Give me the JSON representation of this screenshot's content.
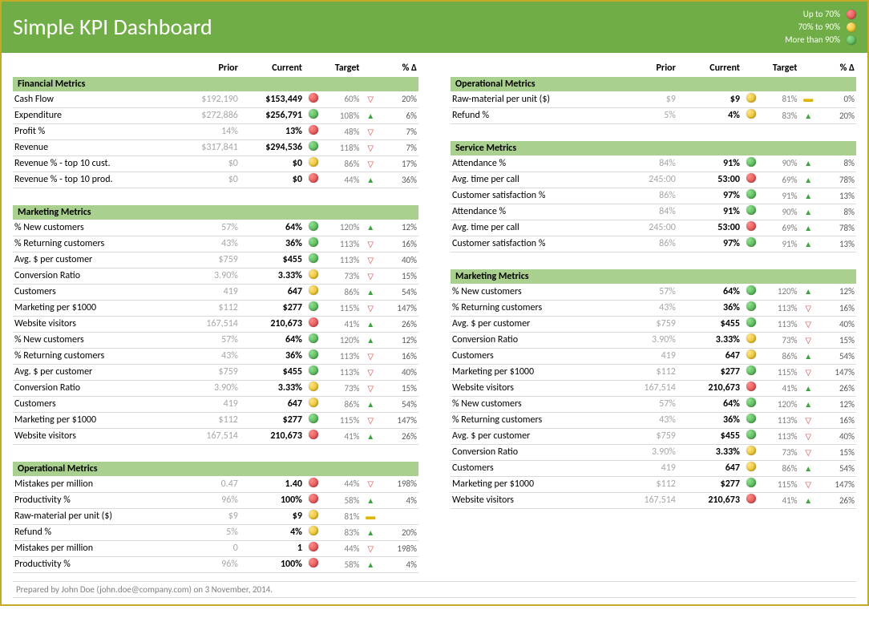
{
  "title": "Simple KPI Dashboard",
  "legend": [
    {
      "label": "Up to 70%",
      "color": "red"
    },
    {
      "label": "70% to 90%",
      "color": "yellow"
    },
    {
      "label": "More than 90%",
      "color": "green"
    }
  ],
  "columns": [
    "",
    "Prior",
    "Current",
    "Target",
    "% Δ"
  ],
  "footer": "Prepared by John Doe (john.doe@company.com) on 3 November, 2014.",
  "left": [
    {
      "section": "Financial Metrics",
      "rows": [
        {
          "name": "Cash Flow",
          "prior": "$192,190",
          "current": "$153,449",
          "status": "red",
          "target": "60%",
          "dir": "down",
          "delta": "20%"
        },
        {
          "name": "Expenditure",
          "prior": "$272,886",
          "current": "$256,791",
          "status": "green",
          "target": "108%",
          "dir": "up",
          "delta": "6%"
        },
        {
          "name": "Profit %",
          "prior": "14%",
          "current": "13%",
          "status": "red",
          "target": "48%",
          "dir": "down",
          "delta": "7%"
        },
        {
          "name": "Revenue",
          "prior": "$317,841",
          "current": "$294,536",
          "status": "green",
          "target": "118%",
          "dir": "down",
          "delta": "7%"
        },
        {
          "name": "Revenue % - top 10 cust.",
          "prior": "$0",
          "current": "$0",
          "status": "yellow",
          "target": "86%",
          "dir": "down",
          "delta": "17%"
        },
        {
          "name": "Revenue % - top 10 prod.",
          "prior": "$0",
          "current": "$0",
          "status": "red",
          "target": "44%",
          "dir": "up",
          "delta": "36%"
        }
      ]
    },
    {
      "section": "Marketing Metrics",
      "rows": [
        {
          "name": "% New customers",
          "prior": "57%",
          "current": "64%",
          "status": "green",
          "target": "120%",
          "dir": "up",
          "delta": "12%"
        },
        {
          "name": "% Returning customers",
          "prior": "43%",
          "current": "36%",
          "status": "green",
          "target": "113%",
          "dir": "down",
          "delta": "16%"
        },
        {
          "name": "Avg. $ per customer",
          "prior": "$759",
          "current": "$455",
          "status": "green",
          "target": "113%",
          "dir": "down",
          "delta": "40%"
        },
        {
          "name": "Conversion Ratio",
          "prior": "3.90%",
          "current": "3.33%",
          "status": "yellow",
          "target": "73%",
          "dir": "down",
          "delta": "15%"
        },
        {
          "name": "Customers",
          "prior": "419",
          "current": "647",
          "status": "yellow",
          "target": "86%",
          "dir": "up",
          "delta": "54%"
        },
        {
          "name": "Marketing per $1000",
          "prior": "$112",
          "current": "$277",
          "status": "green",
          "target": "115%",
          "dir": "down",
          "delta": "147%"
        },
        {
          "name": "Website visitors",
          "prior": "167,514",
          "current": "210,673",
          "status": "red",
          "target": "41%",
          "dir": "up",
          "delta": "26%"
        },
        {
          "name": "% New customers",
          "prior": "57%",
          "current": "64%",
          "status": "green",
          "target": "120%",
          "dir": "up",
          "delta": "12%"
        },
        {
          "name": "% Returning customers",
          "prior": "43%",
          "current": "36%",
          "status": "green",
          "target": "113%",
          "dir": "down",
          "delta": "16%"
        },
        {
          "name": "Avg. $ per customer",
          "prior": "$759",
          "current": "$455",
          "status": "green",
          "target": "113%",
          "dir": "down",
          "delta": "40%"
        },
        {
          "name": "Conversion Ratio",
          "prior": "3.90%",
          "current": "3.33%",
          "status": "yellow",
          "target": "73%",
          "dir": "down",
          "delta": "15%"
        },
        {
          "name": "Customers",
          "prior": "419",
          "current": "647",
          "status": "yellow",
          "target": "86%",
          "dir": "up",
          "delta": "54%"
        },
        {
          "name": "Marketing per $1000",
          "prior": "$112",
          "current": "$277",
          "status": "green",
          "target": "115%",
          "dir": "down",
          "delta": "147%"
        },
        {
          "name": "Website visitors",
          "prior": "167,514",
          "current": "210,673",
          "status": "red",
          "target": "41%",
          "dir": "up",
          "delta": "26%"
        }
      ]
    },
    {
      "section": "Operational Metrics",
      "rows": [
        {
          "name": "Mistakes per million",
          "prior": "0.47",
          "current": "1.40",
          "status": "red",
          "target": "44%",
          "dir": "down",
          "delta": "198%"
        },
        {
          "name": "Productivity %",
          "prior": "96%",
          "current": "100%",
          "status": "red",
          "target": "58%",
          "dir": "up",
          "delta": "4%"
        },
        {
          "name": "Raw-material per unit ($)",
          "prior": "$9",
          "current": "$9",
          "status": "yellow",
          "target": "81%",
          "dir": "flat",
          "delta": ""
        },
        {
          "name": "Refund %",
          "prior": "5%",
          "current": "4%",
          "status": "yellow",
          "target": "83%",
          "dir": "up",
          "delta": "20%"
        },
        {
          "name": "Mistakes per million",
          "prior": "0",
          "current": "1",
          "status": "red",
          "target": "44%",
          "dir": "down",
          "delta": "198%"
        },
        {
          "name": "Productivity %",
          "prior": "96%",
          "current": "100%",
          "status": "red",
          "target": "58%",
          "dir": "up",
          "delta": "4%"
        }
      ]
    }
  ],
  "right": [
    {
      "section": "Operational Metrics",
      "rows": [
        {
          "name": "Raw-material per unit ($)",
          "prior": "$9",
          "current": "$9",
          "status": "yellow",
          "target": "81%",
          "dir": "flat",
          "delta": "0%"
        },
        {
          "name": "Refund %",
          "prior": "5%",
          "current": "4%",
          "status": "yellow",
          "target": "83%",
          "dir": "up",
          "delta": "20%"
        }
      ]
    },
    {
      "section": "Service Metrics",
      "rows": [
        {
          "name": "Attendance %",
          "prior": "84%",
          "current": "91%",
          "status": "green",
          "target": "90%",
          "dir": "up",
          "delta": "8%"
        },
        {
          "name": "Avg. time per call",
          "prior": "245:00",
          "current": "53:00",
          "status": "red",
          "target": "69%",
          "dir": "up",
          "delta": "78%"
        },
        {
          "name": "Customer satisfaction %",
          "prior": "86%",
          "current": "97%",
          "status": "green",
          "target": "91%",
          "dir": "up",
          "delta": "13%"
        },
        {
          "name": "Attendance %",
          "prior": "84%",
          "current": "91%",
          "status": "green",
          "target": "90%",
          "dir": "up",
          "delta": "8%"
        },
        {
          "name": "Avg. time per call",
          "prior": "245:00",
          "current": "53:00",
          "status": "red",
          "target": "69%",
          "dir": "up",
          "delta": "78%"
        },
        {
          "name": "Customer satisfaction %",
          "prior": "86%",
          "current": "97%",
          "status": "green",
          "target": "91%",
          "dir": "up",
          "delta": "13%"
        }
      ]
    },
    {
      "section": "Marketing Metrics",
      "rows": [
        {
          "name": "% New customers",
          "prior": "57%",
          "current": "64%",
          "status": "green",
          "target": "120%",
          "dir": "up",
          "delta": "12%"
        },
        {
          "name": "% Returning customers",
          "prior": "43%",
          "current": "36%",
          "status": "green",
          "target": "113%",
          "dir": "down",
          "delta": "16%"
        },
        {
          "name": "Avg. $ per customer",
          "prior": "$759",
          "current": "$455",
          "status": "green",
          "target": "113%",
          "dir": "down",
          "delta": "40%"
        },
        {
          "name": "Conversion Ratio",
          "prior": "3.90%",
          "current": "3.33%",
          "status": "yellow",
          "target": "73%",
          "dir": "down",
          "delta": "15%"
        },
        {
          "name": "Customers",
          "prior": "419",
          "current": "647",
          "status": "yellow",
          "target": "86%",
          "dir": "up",
          "delta": "54%"
        },
        {
          "name": "Marketing per $1000",
          "prior": "$112",
          "current": "$277",
          "status": "green",
          "target": "115%",
          "dir": "down",
          "delta": "147%"
        },
        {
          "name": "Website visitors",
          "prior": "167,514",
          "current": "210,673",
          "status": "red",
          "target": "41%",
          "dir": "up",
          "delta": "26%"
        },
        {
          "name": "% New customers",
          "prior": "57%",
          "current": "64%",
          "status": "green",
          "target": "120%",
          "dir": "up",
          "delta": "12%"
        },
        {
          "name": "% Returning customers",
          "prior": "43%",
          "current": "36%",
          "status": "green",
          "target": "113%",
          "dir": "down",
          "delta": "16%"
        },
        {
          "name": "Avg. $ per customer",
          "prior": "$759",
          "current": "$455",
          "status": "green",
          "target": "113%",
          "dir": "down",
          "delta": "40%"
        },
        {
          "name": "Conversion Ratio",
          "prior": "3.90%",
          "current": "3.33%",
          "status": "yellow",
          "target": "73%",
          "dir": "down",
          "delta": "15%"
        },
        {
          "name": "Customers",
          "prior": "419",
          "current": "647",
          "status": "yellow",
          "target": "86%",
          "dir": "up",
          "delta": "54%"
        },
        {
          "name": "Marketing per $1000",
          "prior": "$112",
          "current": "$277",
          "status": "green",
          "target": "115%",
          "dir": "down",
          "delta": "147%"
        },
        {
          "name": "Website visitors",
          "prior": "167,514",
          "current": "210,673",
          "status": "red",
          "target": "41%",
          "dir": "up",
          "delta": "26%"
        }
      ]
    }
  ]
}
